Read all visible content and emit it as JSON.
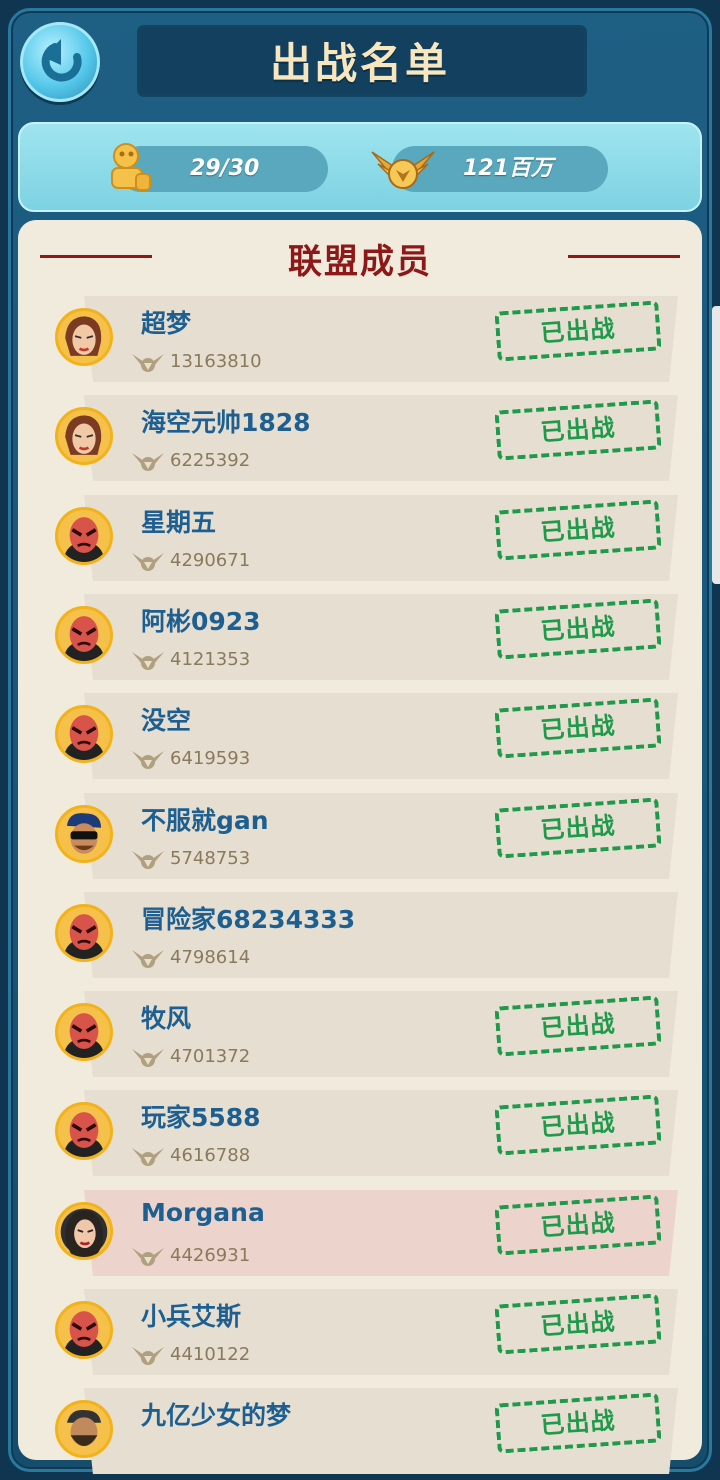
{
  "title": "出战名单",
  "stats": {
    "troops": "29/30",
    "power": "121百万"
  },
  "section_title": "联盟成员",
  "deployed_label": "已出战",
  "members": [
    {
      "name": "超梦",
      "power": "13163810",
      "deployed": true,
      "avatar": "woman-avatar"
    },
    {
      "name": "海空元帅1828",
      "power": "6225392",
      "deployed": true,
      "avatar": "woman-avatar"
    },
    {
      "name": "星期五",
      "power": "4290671",
      "deployed": true,
      "avatar": "red-mask-avatar"
    },
    {
      "name": "阿彬0923",
      "power": "4121353",
      "deployed": true,
      "avatar": "red-mask-avatar"
    },
    {
      "name": "没空",
      "power": "6419593",
      "deployed": true,
      "avatar": "red-mask-avatar"
    },
    {
      "name": "不服就gan",
      "power": "5748753",
      "deployed": true,
      "avatar": "sunglasses-avatar"
    },
    {
      "name": "冒险家68234333",
      "power": "4798614",
      "deployed": false,
      "avatar": "red-mask-avatar"
    },
    {
      "name": "牧风",
      "power": "4701372",
      "deployed": true,
      "avatar": "red-mask-avatar"
    },
    {
      "name": "玩家5588",
      "power": "4616788",
      "deployed": true,
      "avatar": "red-mask-avatar"
    },
    {
      "name": "Morgana",
      "power": "4426931",
      "deployed": true,
      "avatar": "dark-hair-avatar",
      "highlight": true
    },
    {
      "name": "小兵艾斯",
      "power": "4410122",
      "deployed": true,
      "avatar": "red-mask-avatar"
    },
    {
      "name": "九亿少女的梦",
      "power": "",
      "deployed": true,
      "avatar": "bearded-avatar"
    }
  ]
}
